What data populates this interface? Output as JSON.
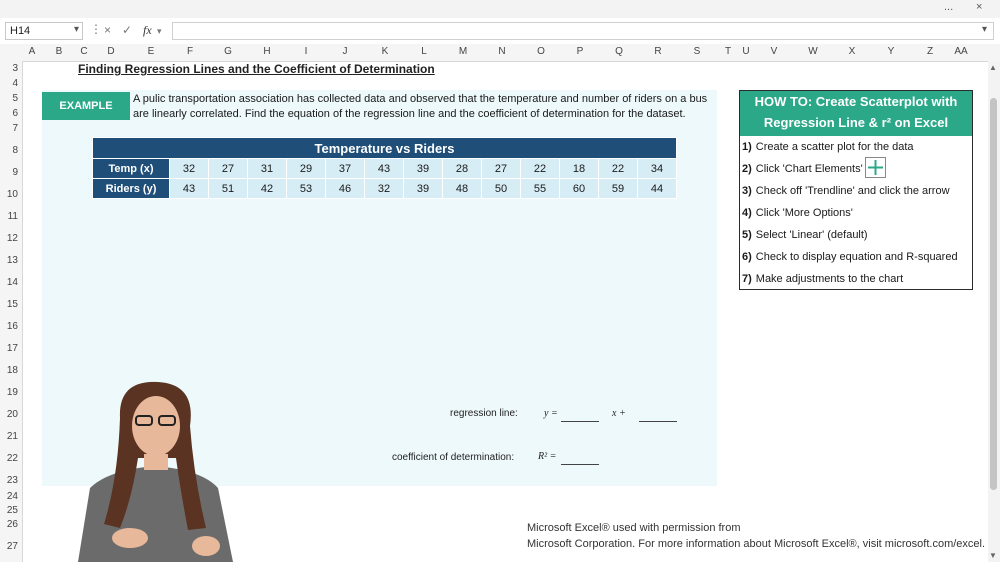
{
  "window": {
    "controls": [
      "...",
      "×"
    ]
  },
  "formula_bar": {
    "cell_ref": "H14",
    "cancel_icon": "×",
    "enter_icon": "✓",
    "fx_label": "fx",
    "value": ""
  },
  "columns": [
    "A",
    "B",
    "C",
    "D",
    "E",
    "F",
    "G",
    "H",
    "I",
    "J",
    "K",
    "L",
    "M",
    "N",
    "O",
    "P",
    "Q",
    "R",
    "S",
    "T",
    "U",
    "V",
    "W",
    "X",
    "Y",
    "Z",
    "AA"
  ],
  "rows": [
    "3",
    "4",
    "5",
    "6",
    "7",
    "8",
    "9",
    "10",
    "11",
    "12",
    "13",
    "14",
    "15",
    "16",
    "17",
    "18",
    "19",
    "20",
    "21",
    "22",
    "23",
    "24",
    "25",
    "26",
    "27"
  ],
  "heading": "Finding Regression Lines and the Coefficient of Determination",
  "example": {
    "badge": "EXAMPLE",
    "line1": "A pulic transportation association has collected data and observed that the temperature and number of riders on a bus",
    "line2": "are linearly correlated. Find the equation of the regression line and the coefficient of determination for the dataset."
  },
  "table": {
    "title": "Temperature vs Riders",
    "row1_label": "Temp (x)",
    "row2_label": "Riders (y)",
    "temps": [
      "32",
      "27",
      "31",
      "29",
      "37",
      "43",
      "39",
      "28",
      "27",
      "22",
      "18",
      "22",
      "34"
    ],
    "riders": [
      "43",
      "51",
      "42",
      "53",
      "46",
      "32",
      "39",
      "48",
      "50",
      "55",
      "60",
      "59",
      "44"
    ]
  },
  "answers": {
    "regression_label": "regression line:",
    "y_eq": "y =",
    "x_plus": "x +",
    "coef_label": "coefficient of determination:",
    "r2_eq": "R² ="
  },
  "howto": {
    "title_line1": "HOW TO: Create Scatterplot with",
    "title_line2": "Regression Line & r² on Excel",
    "steps": [
      {
        "num": "1)",
        "text": "Create a scatter plot for the data"
      },
      {
        "num": "2)",
        "text": "Click 'Chart Elements'"
      },
      {
        "num": "3)",
        "text": "Check off 'Trendline' and click the arrow"
      },
      {
        "num": "4)",
        "text": "Click 'More Options'"
      },
      {
        "num": "5)",
        "text": "Select 'Linear' (default)"
      },
      {
        "num": "6)",
        "text": "Check to display equation and R-squared"
      },
      {
        "num": "7)",
        "text": "Make adjustments to the chart"
      }
    ],
    "plus_icon": "+"
  },
  "credit": {
    "line1": "Microsoft Excel® used with permission from",
    "line2": "Microsoft Corporation. For more information about Microsoft Excel®, visit microsoft.com/excel."
  },
  "colors": {
    "accent": "#2aa888",
    "table_header": "#1f4e79",
    "table_cell": "#d7edf6",
    "panel": "#eef9fc"
  }
}
